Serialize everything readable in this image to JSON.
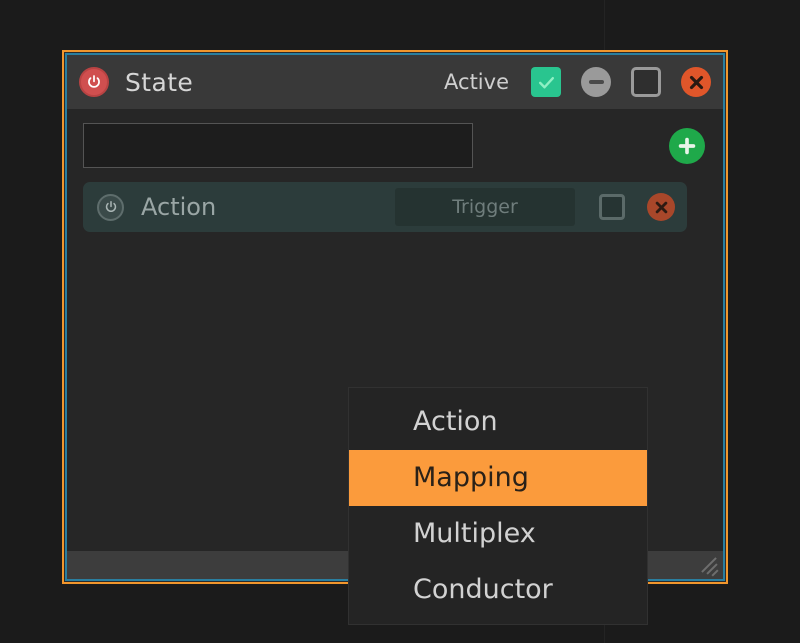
{
  "window": {
    "title": "State",
    "accent_border_color": "#f1962c",
    "inner_border_color": "#2a7fa0",
    "titlebar": {
      "power_icon": "power-icon",
      "active_label": "Active",
      "active_checked": true,
      "check_color": "#29c58f",
      "minimize_icon": "minimize-icon",
      "maximize_icon": "maximize-icon",
      "close_icon": "close-icon",
      "close_color": "#e0562a"
    },
    "input": {
      "value": "",
      "placeholder": ""
    },
    "add_button": {
      "icon": "plus-icon",
      "color": "#1fa94a"
    },
    "rows": [
      {
        "power_icon": "power-icon",
        "label": "Action",
        "trigger_label": "Trigger",
        "checkbox_checked": false,
        "close_icon": "close-icon",
        "background": "#2c3c3b"
      }
    ],
    "statusbar": {
      "resize_grip_icon": "resize-grip-icon"
    }
  },
  "context_menu": {
    "items": [
      {
        "label": "Action",
        "selected": false
      },
      {
        "label": "Mapping",
        "selected": true
      },
      {
        "label": "Multiplex",
        "selected": false
      },
      {
        "label": "Conductor",
        "selected": false
      }
    ],
    "highlight_color": "#fb9b3c"
  }
}
